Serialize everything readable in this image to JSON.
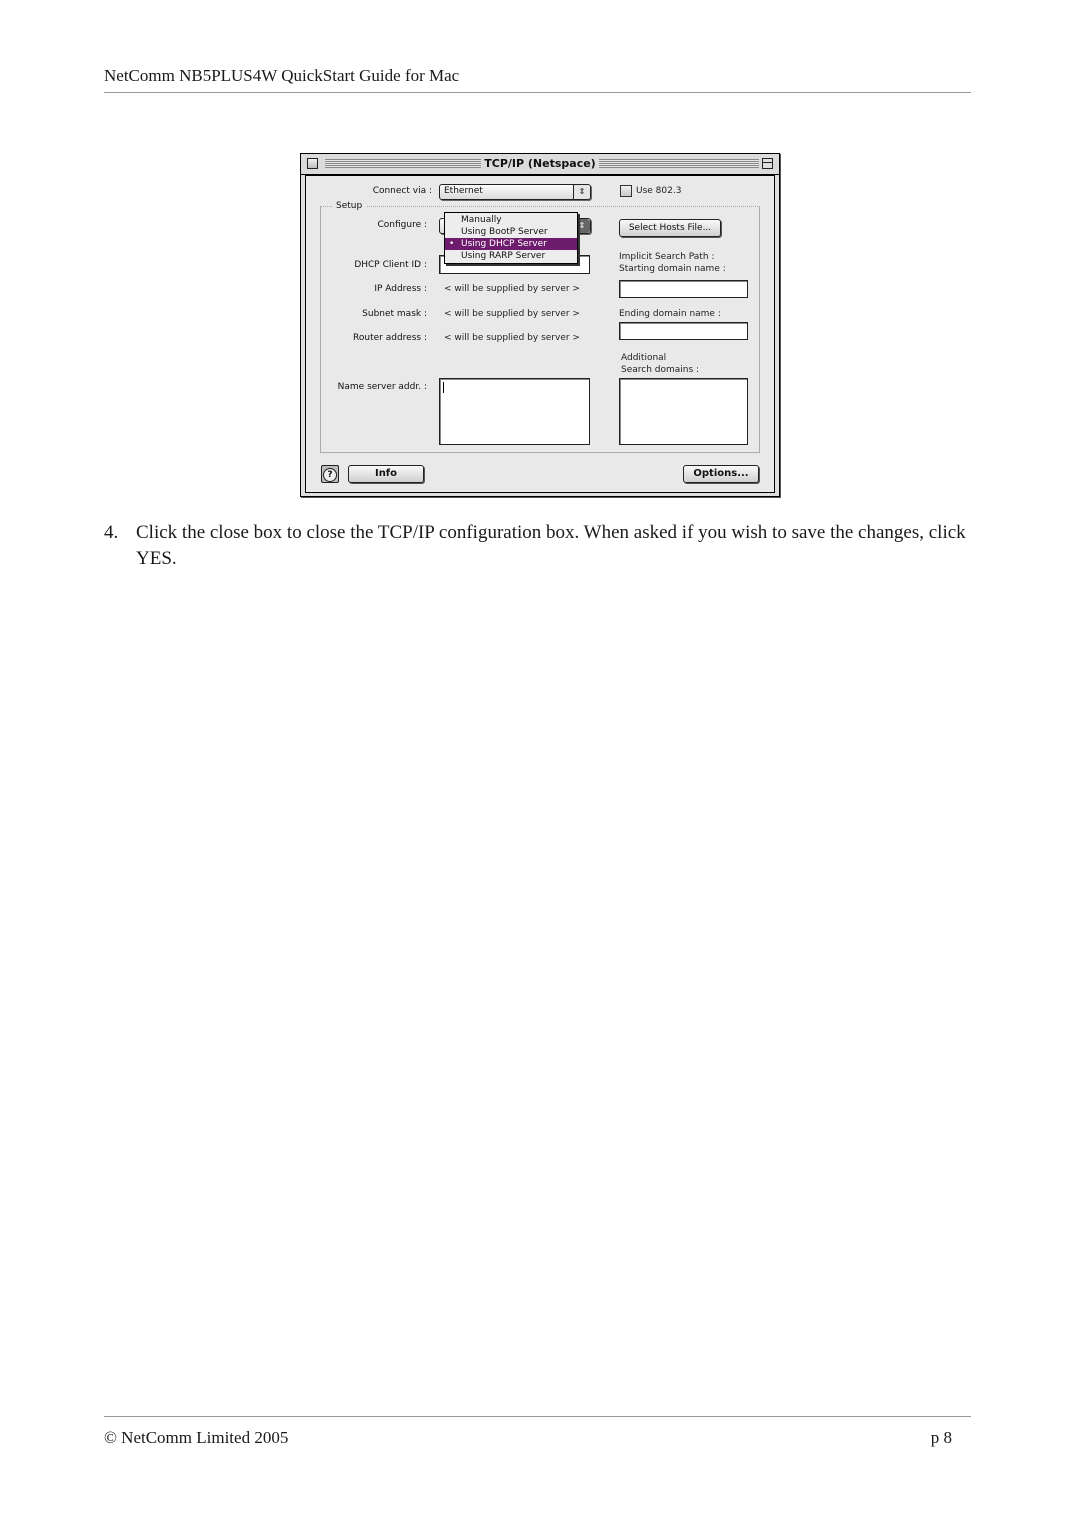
{
  "page": {
    "header": "NetComm NB5PLUS4W QuickStart Guide for Mac",
    "footer_left": "© NetComm Limited 2005",
    "footer_right": "p 8"
  },
  "step": {
    "number": "4.",
    "text": "Click the close box to close the TCP/IP configuration box. When asked if you wish to save the changes, click YES."
  },
  "dialog": {
    "title": "TCP/IP (Netspace)",
    "connect_via_label": "Connect via :",
    "connect_via_value": "Ethernet",
    "use_8023_label": "Use 802.3",
    "use_8023_checked": false,
    "setup_label": "Setup",
    "configure_label": "Configure :",
    "configure_menu": {
      "items": [
        "Manually",
        "Using BootP Server",
        "Using DHCP Server",
        "Using RARP Server"
      ],
      "selected": "Using DHCP Server",
      "selected_marker": "•"
    },
    "select_hosts_button": "Select Hosts File...",
    "dhcp_client_id_label": "DHCP Client ID :",
    "dhcp_client_id_value": "",
    "ip_address_label": "IP Address :",
    "ip_address_value": "< will be supplied by server >",
    "subnet_mask_label": "Subnet mask :",
    "subnet_mask_value": "< will be supplied by server >",
    "router_address_label": "Router address :",
    "router_address_value": "< will be supplied by server >",
    "name_server_label": "Name server addr. :",
    "name_server_value": "",
    "implicit_search_path_label": "Implicit Search Path :",
    "starting_domain_label": "Starting domain name :",
    "starting_domain_value": "",
    "ending_domain_label": "Ending domain name :",
    "ending_domain_value": "",
    "additional_label": "Additional",
    "search_domains_label": "Search domains :",
    "search_domains_value": "",
    "help_icon": "?",
    "info_button": "Info",
    "options_button": "Options..."
  },
  "colors": {
    "menu_highlight": "#6e1c6e",
    "dialog_bg": "#e9e9e9"
  }
}
